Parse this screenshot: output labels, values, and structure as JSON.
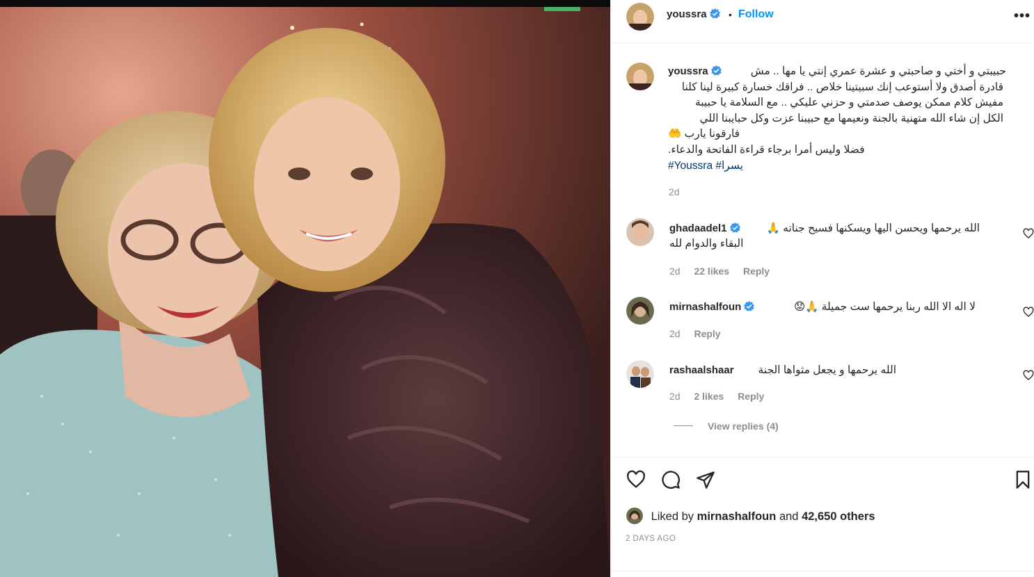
{
  "post": {
    "username": "youssra",
    "follow_label": "Follow",
    "dot": "•",
    "more_label": "•••",
    "caption": {
      "username": "youssra",
      "lines": [
        "حبيبتي و أختي و صاحبتي و عشرة عمري إنتي يا مها .. مش",
        "قادرة أصدق ولا أستوعب إنك سبيتينا خلاص .. فراقك خسارة كبيرة لينا كلنا",
        "مفيش كلام ممكن يوصف صدمتي و حزني عليكي .. مع السلامة يا حبيبة",
        "الكل إن شاء الله متهنية بالجنة ونعيمها مع حبيبنا عزت وكل حبايبنا اللي",
        "فارقونا يارب 🤲",
        ".فضلا وليس أمرا برجاء قراءة الفاتحة والدعاء"
      ],
      "hashtags": "#Youssra #يسرا",
      "time": "2d"
    },
    "comments": [
      {
        "username": "ghadaadel1",
        "verified": true,
        "lines": [
          "الله يرحمها ويحسن اليها ويسكنها فسيح جناته 🙏",
          "البقاء والدوام لله"
        ],
        "time": "2d",
        "likes": "22 likes",
        "reply": "Reply"
      },
      {
        "username": "mirnashalfoun",
        "verified": true,
        "lines": [
          "لا اله الا الله ربنا يرحمها ست جميلة 🙏😟"
        ],
        "time": "2d",
        "likes": "",
        "reply": "Reply"
      },
      {
        "username": "rashaalshaar",
        "verified": false,
        "lines": [
          "الله يرحمها و يجعل مثواها الجنة"
        ],
        "time": "2d",
        "likes": "2 likes",
        "reply": "Reply",
        "view_replies": "View replies (4)"
      }
    ],
    "liked_by": {
      "prefix": "Liked by",
      "user": "mirnashalfoun",
      "and": "and",
      "others": "42,650 others"
    },
    "posted_ago": "2 DAYS AGO"
  },
  "icons": {
    "like": "heart-icon",
    "comment": "comment-icon",
    "share": "paper-plane-icon",
    "save": "bookmark-icon",
    "verified": "verified-badge-icon",
    "more": "more-options-icon"
  },
  "colors": {
    "link_blue": "#0095f6",
    "verified_blue": "#3897f0",
    "hashtag": "#00376b",
    "muted": "#8e8e8e",
    "border": "#efefef"
  }
}
